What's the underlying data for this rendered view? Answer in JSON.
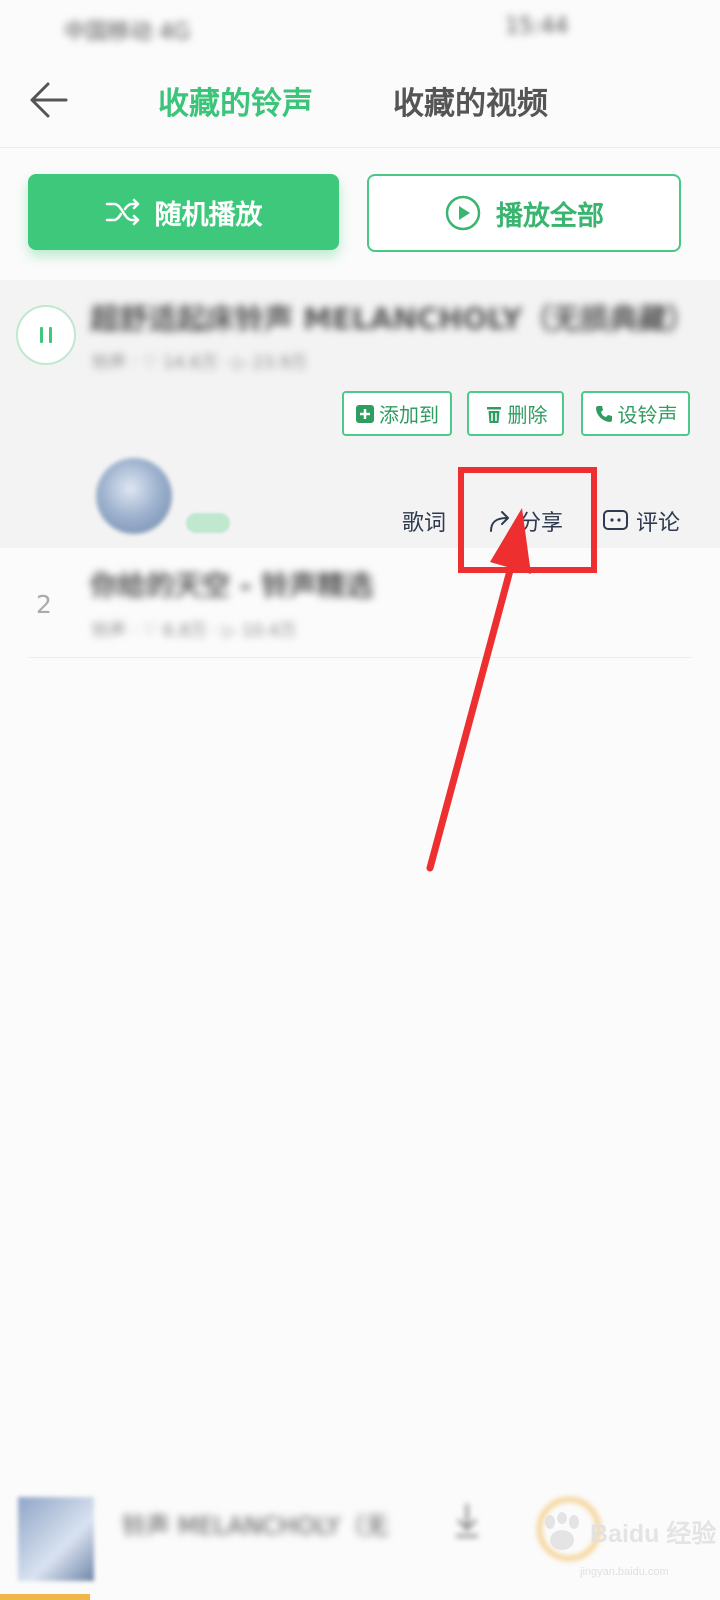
{
  "status_bar": {
    "left_text": "中国移动 4G",
    "right_text": "15:44"
  },
  "header": {
    "back_icon": "arrow-left-icon",
    "tabs": [
      {
        "label": "收藏的铃声",
        "active": true
      },
      {
        "label": "收藏的视频",
        "active": false
      }
    ]
  },
  "actions": {
    "shuffle_label": "随机播放",
    "shuffle_icon": "shuffle-icon",
    "play_all_label": "播放全部",
    "play_all_icon": "play-circle-icon"
  },
  "songs": [
    {
      "title": "超舒适起床铃声 MELANCHOLY（无损典藏）",
      "meta": "铃声 · ♡ 14.6万 · ▷ 23.9万",
      "playing": true,
      "chips": [
        {
          "label": "添加到",
          "icon": "plus-square-icon"
        },
        {
          "label": "删除",
          "icon": "trash-icon"
        },
        {
          "label": "设铃声",
          "icon": "phone-icon"
        }
      ],
      "row_actions": [
        {
          "label": "歌词",
          "icon": ""
        },
        {
          "label": "分享",
          "icon": "share-icon"
        },
        {
          "label": "评论",
          "icon": "comment-icon"
        }
      ]
    },
    {
      "index": "2",
      "title": "你给的天空 - 铃声精选",
      "meta": "铃声 · ♡ 6.8万 · ▷ 10.4万"
    }
  ],
  "mini_player": {
    "title": "铃声 MELANCHOLY（无"
  },
  "watermark": {
    "text": "Baidu 经验",
    "site": "jingyan.baidu.com"
  },
  "colors": {
    "accent": "#3ec87c",
    "annotation": "#ee2f2f"
  }
}
